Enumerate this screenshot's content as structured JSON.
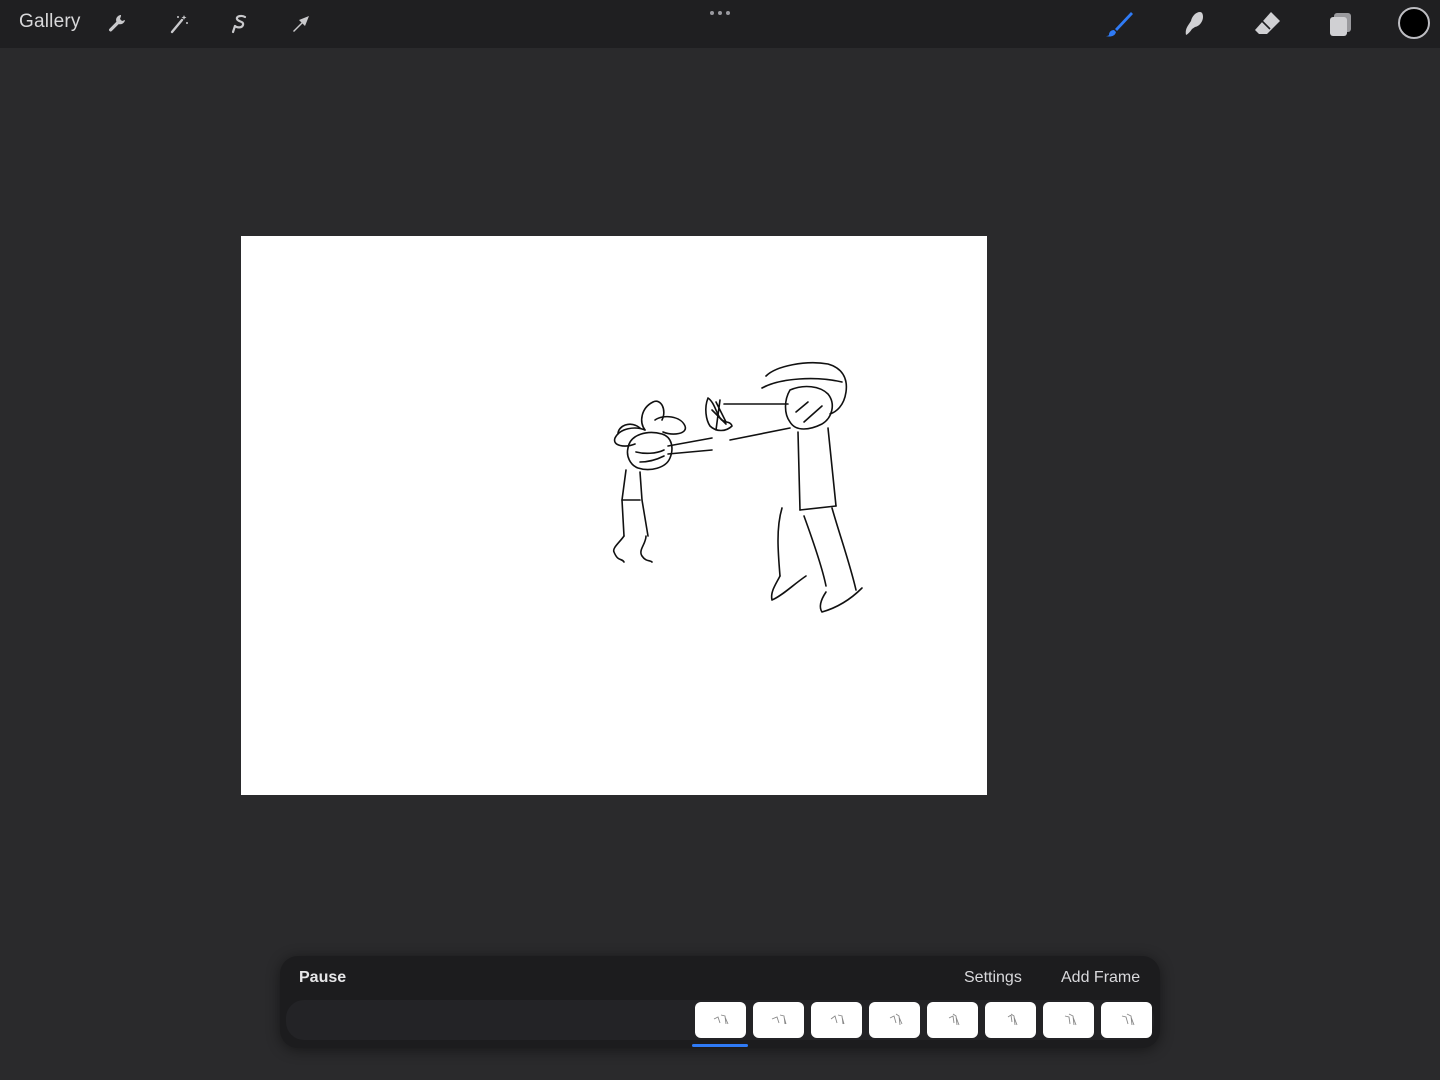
{
  "toolbar": {
    "gallery_label": "Gallery",
    "left_tools": [
      "wrench-icon",
      "magic-wand-icon",
      "selection-icon",
      "transform-arrow-icon"
    ],
    "right_tools": [
      "brush-icon",
      "smudge-icon",
      "eraser-icon",
      "layers-icon"
    ],
    "active_tool": "brush-icon",
    "accent_color": "#2f7bf6",
    "current_color": "#000000"
  },
  "animation_assist": {
    "play_label": "Pause",
    "settings_label": "Settings",
    "add_frame_label": "Add Frame",
    "frame_count": 8,
    "selected_frame_index": 1
  }
}
